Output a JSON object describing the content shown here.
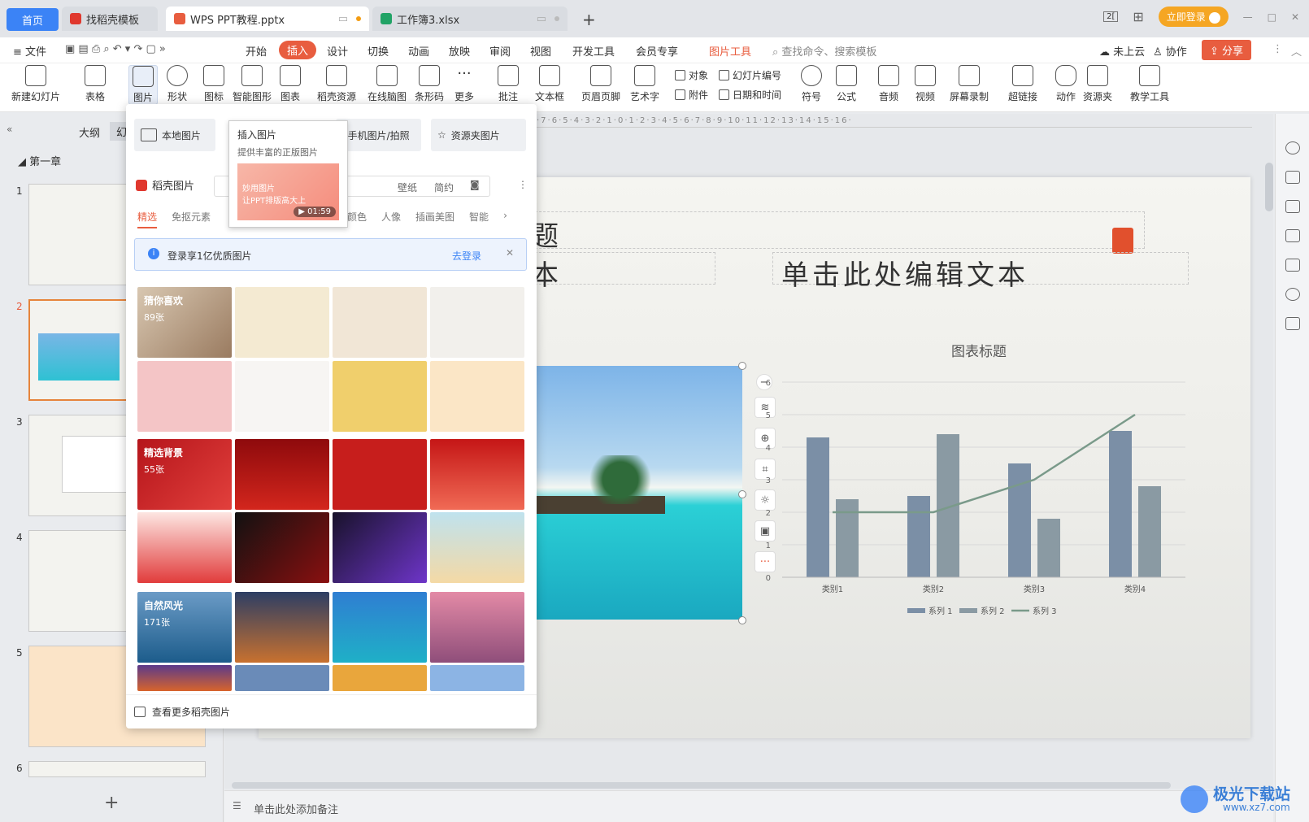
{
  "tabs": {
    "home": "首页",
    "template": "找稻壳模板",
    "ppt": "WPS PPT教程.pptx",
    "xlsx": "工作簿3.xlsx",
    "new_tab": "+"
  },
  "window": {
    "login_button": "立即登录",
    "minimize": "—",
    "restore": "□",
    "close": "✕",
    "layout_icon": "2[",
    "grid_icon": "⊞"
  },
  "menu": {
    "file": "≡ 文件",
    "items": [
      "开始",
      "插入",
      "设计",
      "切换",
      "动画",
      "放映",
      "审阅",
      "视图",
      "开发工具",
      "会员专享"
    ],
    "picture_tools": "图片工具",
    "search": "查找命令、搜索模板",
    "cloud": "未上云",
    "collab": "协作",
    "share": "分享"
  },
  "ribbon": {
    "big": [
      "新建幻灯片",
      "表格",
      "图片",
      "形状",
      "图标",
      "智能图形",
      "图表",
      "稻壳资源",
      "在线脑图",
      "条形码",
      "更多",
      "批注",
      "文本框",
      "页眉页脚",
      "艺术字",
      "符号",
      "公式",
      "音频",
      "视频",
      "屏幕录制",
      "超链接",
      "动作",
      "资源夹",
      "教学工具"
    ],
    "small": {
      "object": "对象",
      "slide_num": "幻灯片编号",
      "attach": "附件",
      "datetime": "日期和时间"
    }
  },
  "left_panel": {
    "outline_tab": "大纲",
    "slides_tab": "幻",
    "section": "第一章",
    "slide_numbers": [
      "1",
      "2",
      "3",
      "4",
      "5",
      "6"
    ],
    "add": "+"
  },
  "popup": {
    "local_image": "本地图片",
    "phone_image": "手机图片/拍照",
    "resource_image": "资源夹图片",
    "docer_images": "稻壳图片",
    "search_tags": [
      "壁纸",
      "简约"
    ],
    "tabs": [
      "精选",
      "免抠元素",
      "颜色",
      "人像",
      "插画美图",
      "智能"
    ],
    "login_tip": "登录享1亿优质图片",
    "login_link": "去登录",
    "categories": [
      {
        "name": "猜你喜欢",
        "count": "89张"
      },
      {
        "name": "精选背景",
        "count": "55张"
      },
      {
        "name": "自然风光",
        "count": "171张"
      }
    ],
    "more": "查看更多稻壳图片"
  },
  "tooltip": {
    "title": "插入图片",
    "desc": "提供丰富的正版图片",
    "video_line1": "妙用图片",
    "video_line2": "让PPT排版高大上",
    "video_time": "01:59"
  },
  "slide": {
    "title": "标题",
    "text_left": "文本",
    "text_right": "单击此处编辑文本"
  },
  "chart_data": {
    "type": "bar",
    "title": "图表标题",
    "categories": [
      "类别1",
      "类别2",
      "类别3",
      "类别4"
    ],
    "series": [
      {
        "name": "系列 1",
        "type": "bar",
        "color": "#7b8fa6",
        "values": [
          4.3,
          2.5,
          3.5,
          4.5
        ]
      },
      {
        "name": "系列 2",
        "type": "bar",
        "color": "#8a9aa3",
        "values": [
          2.4,
          4.4,
          1.8,
          2.8
        ]
      },
      {
        "name": "系列 3",
        "type": "line",
        "color": "#7a9a8a",
        "values": [
          2,
          2,
          3,
          5
        ]
      }
    ],
    "ylim": [
      0,
      6
    ],
    "yticks": [
      "0",
      "1",
      "2",
      "3",
      "4",
      "5",
      "6"
    ],
    "legend": "bottom",
    "grid": true
  },
  "notes": {
    "placeholder": "单击此处添加备注"
  },
  "watermark": {
    "name": "极光下载站",
    "url": "www.xz7.com"
  }
}
